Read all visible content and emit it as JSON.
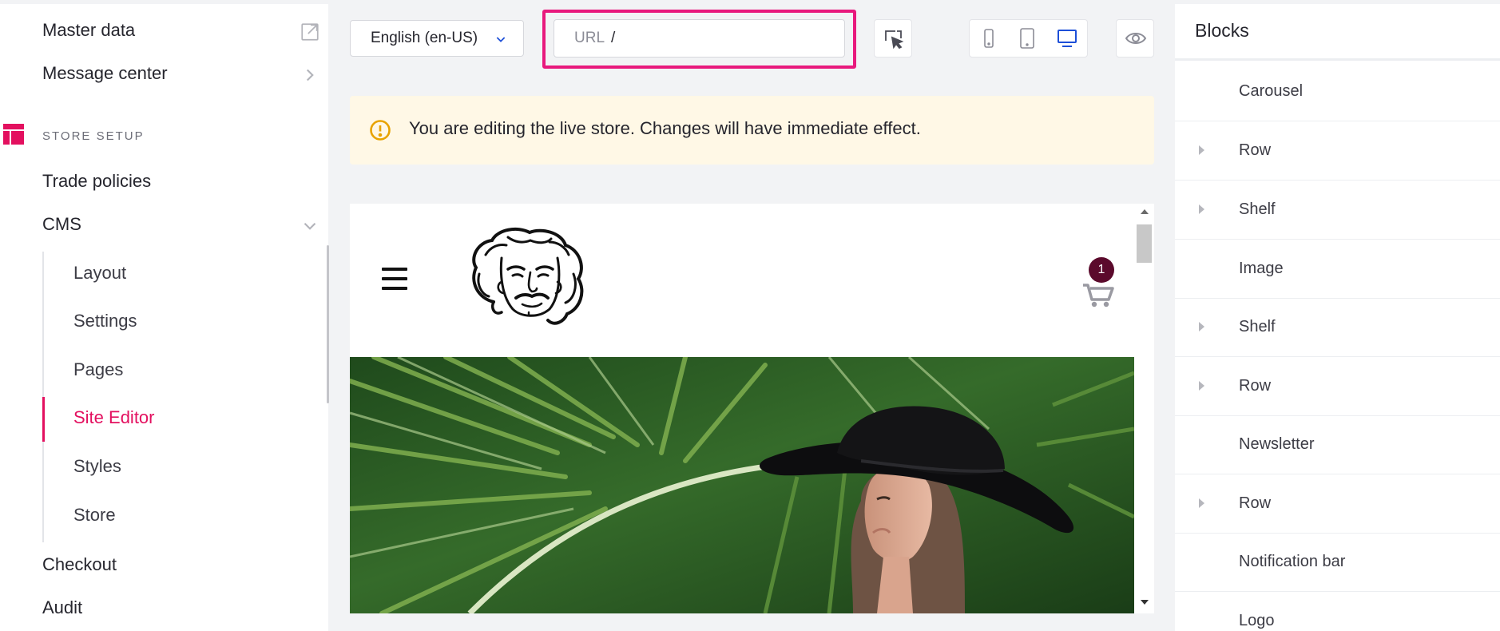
{
  "colors": {
    "accent": "#e3105f",
    "highlight": "#e8197d",
    "device_active": "#1d4fd8",
    "alert_bg": "#fff8e6",
    "alert_icon": "#e8a300",
    "badge": "#5b0a2c"
  },
  "sidebar": {
    "items_top": [
      {
        "label": "Master data",
        "icon": "external-link-icon"
      },
      {
        "label": "Message center",
        "icon": "chevron-right-icon"
      }
    ],
    "section_label": "STORE SETUP",
    "section_icon": "layout-icon",
    "trade_policies": "Trade policies",
    "cms": {
      "label": "CMS",
      "icon": "chevron-down-icon"
    },
    "cms_children": [
      {
        "label": "Layout"
      },
      {
        "label": "Settings"
      },
      {
        "label": "Pages"
      },
      {
        "label": "Site Editor",
        "active": true
      },
      {
        "label": "Styles"
      },
      {
        "label": "Store"
      }
    ],
    "checkout": "Checkout",
    "audit": "Audit"
  },
  "toolbar": {
    "language": "English (en-US)",
    "url_label": "URL",
    "url_value": "/",
    "selector_icon": "cursor-select-icon",
    "devices": [
      "mobile-icon",
      "tablet-icon",
      "desktop-icon"
    ],
    "active_device": "desktop-icon",
    "preview_icon": "eye-icon"
  },
  "alert": {
    "icon": "warning-circle-icon",
    "message": "You are editing the live store. Changes will have immediate effect."
  },
  "preview": {
    "cart_count": "1"
  },
  "blocks": {
    "title": "Blocks",
    "items": [
      {
        "label": "Carousel",
        "expandable": false
      },
      {
        "label": "Row",
        "expandable": true
      },
      {
        "label": "Shelf",
        "expandable": true
      },
      {
        "label": "Image",
        "expandable": false
      },
      {
        "label": "Shelf",
        "expandable": true
      },
      {
        "label": "Row",
        "expandable": true
      },
      {
        "label": "Newsletter",
        "expandable": false
      },
      {
        "label": "Row",
        "expandable": true
      },
      {
        "label": "Notification bar",
        "expandable": false
      },
      {
        "label": "Logo",
        "expandable": false
      }
    ]
  }
}
